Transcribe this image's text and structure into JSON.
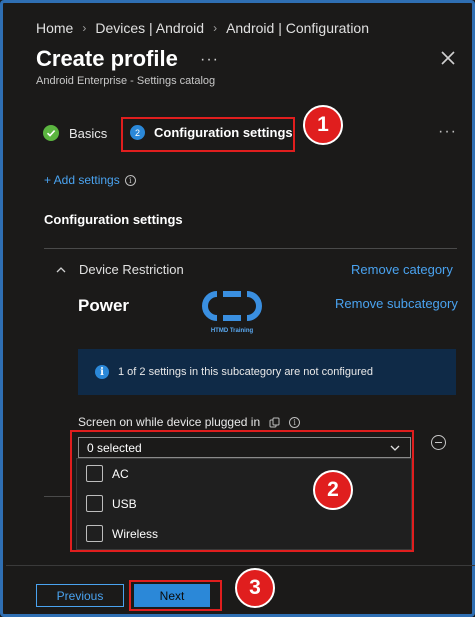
{
  "breadcrumb": {
    "items": [
      "Home",
      "Devices | Android",
      "Android | Configuration"
    ]
  },
  "header": {
    "title": "Create profile",
    "more": "···",
    "subtitle": "Android Enterprise - Settings catalog"
  },
  "steps": [
    {
      "label": "Basics",
      "state": "complete"
    },
    {
      "number": "2",
      "label": "Configuration settings",
      "state": "current"
    }
  ],
  "add_settings": "+ Add settings",
  "section_title": "Configuration settings",
  "category": {
    "name": "Device Restriction",
    "remove_label": "Remove category"
  },
  "subcategory": {
    "name": "Power",
    "remove_label": "Remove subcategory",
    "logo_text": "HTMD Training"
  },
  "info_banner": "1 of 2 settings in this subcategory are not configured",
  "setting": {
    "label": "Screen on while device plugged in",
    "selected_value": "0 selected",
    "options": [
      {
        "label": "AC",
        "checked": false
      },
      {
        "label": "USB",
        "checked": false
      },
      {
        "label": "Wireless",
        "checked": false
      }
    ]
  },
  "callouts": [
    "1",
    "2",
    "3"
  ],
  "footer": {
    "previous_label": "Previous",
    "next_label": "Next"
  },
  "colors": {
    "accent": "#2b88d8",
    "link": "#4aa3f0",
    "highlight": "#e01e1e",
    "success": "#5bb540"
  }
}
